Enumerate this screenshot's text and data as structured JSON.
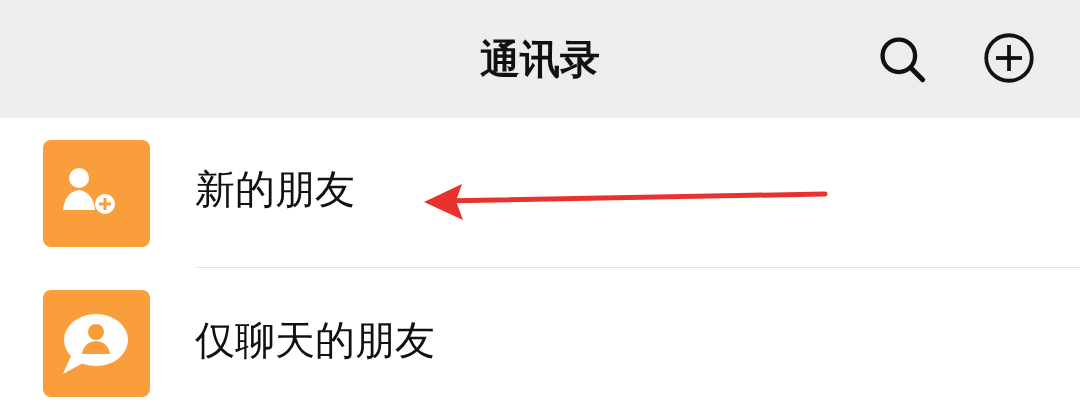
{
  "header": {
    "title": "通讯录"
  },
  "toolbar": [
    {
      "kind": "search"
    },
    {
      "kind": "add"
    }
  ],
  "items": [
    {
      "label": "新的朋友",
      "kind": "new-friend"
    },
    {
      "label": "仅聊天的朋友",
      "kind": "chat-only"
    }
  ],
  "annotation": {
    "kind": "arrow"
  }
}
